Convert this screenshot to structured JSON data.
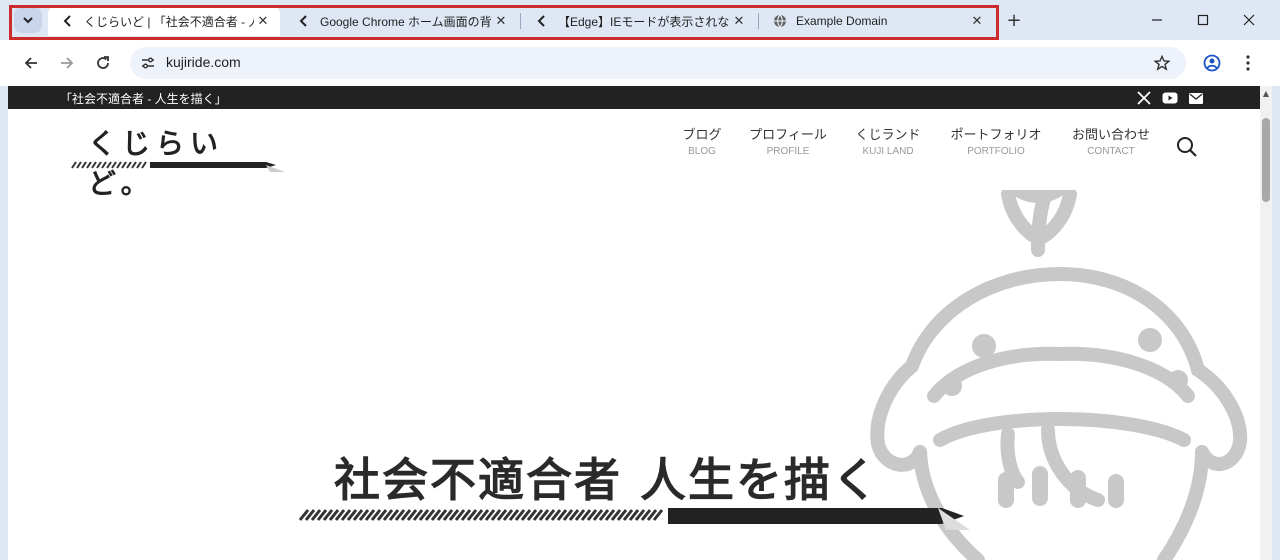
{
  "browser": {
    "tabs": [
      {
        "title": "くじらいど | 「社会不適合者 - 人生を描く」",
        "active": true,
        "icon": "chevron-left-icon"
      },
      {
        "title": "Google Chrome ホーム画面の背景",
        "active": false,
        "icon": "chevron-left-icon"
      },
      {
        "title": "【Edge】IEモードが表示されない・再起動",
        "active": false,
        "icon": "chevron-left-icon"
      },
      {
        "title": "Example Domain",
        "active": false,
        "icon": "globe-icon"
      }
    ],
    "new_tab_label": "+",
    "url": "kujiride.com",
    "highlight_color": "#cc2b2b"
  },
  "site": {
    "topbar_text": "「社会不適合者 - 人生を描く」",
    "logo_text": "くじらいど。",
    "nav": [
      {
        "jp": "ブログ",
        "en": "BLOG"
      },
      {
        "jp": "プロフィール",
        "en": "PROFILE"
      },
      {
        "jp": "くじランド",
        "en": "KUJI LAND"
      },
      {
        "jp": "ポートフォリオ",
        "en": "PORTFOLIO"
      },
      {
        "jp": "お問い合わせ",
        "en": "CONTACT"
      }
    ],
    "hero_title": "社会不適合者 人生を描く",
    "social_icons": [
      "x-icon",
      "youtube-icon",
      "mail-icon"
    ]
  }
}
